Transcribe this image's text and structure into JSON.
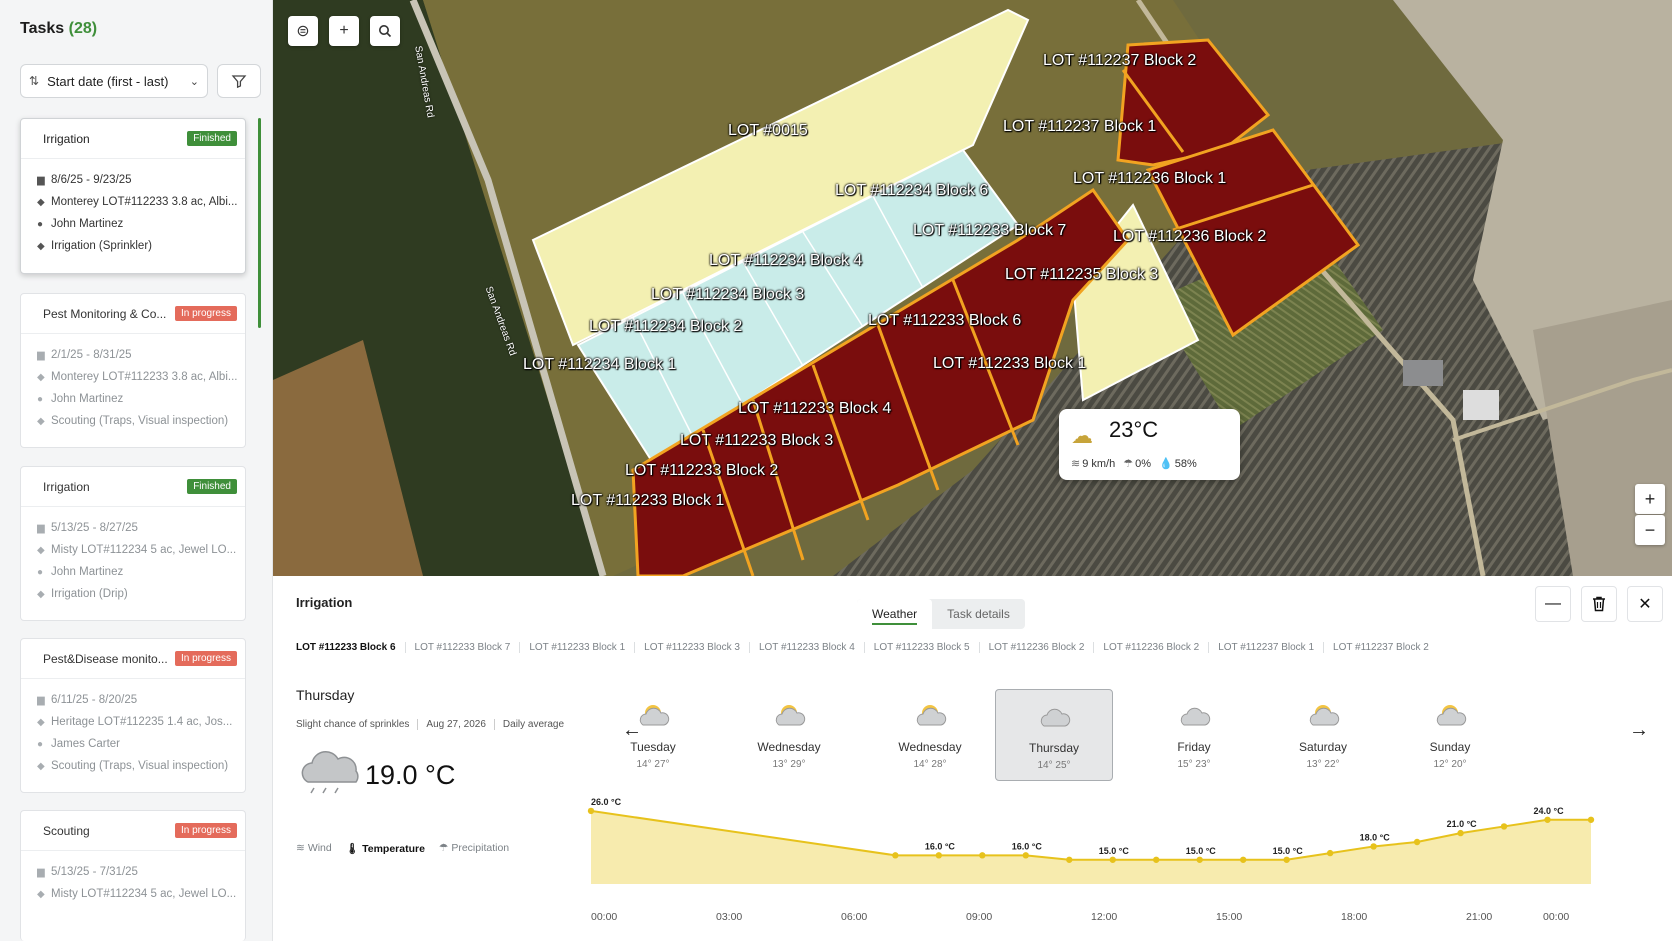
{
  "sidebar": {
    "title": "Tasks",
    "count": "(28)",
    "sort_label": "Start date (first - last)",
    "tasks": [
      {
        "name": "Irrigation",
        "status": "Finished",
        "status_type": "finished",
        "dates": "8/6/25 - 9/23/25",
        "location": "Monterey LOT#112233 3.8 ac, Albi...",
        "assignee": "John Martinez",
        "activity": "Irrigation (Sprinkler)"
      },
      {
        "name": "Pest Monitoring & Co...",
        "status": "In progress",
        "status_type": "progress",
        "dates": "2/1/25 - 8/31/25",
        "location": "Monterey LOT#112233 3.8 ac, Albi...",
        "assignee": "John Martinez",
        "activity": "Scouting (Traps, Visual inspection)"
      },
      {
        "name": "Irrigation",
        "status": "Finished",
        "status_type": "finished",
        "dates": "5/13/25 - 8/27/25",
        "location": "Misty LOT#112234 5 ac, Jewel LO...",
        "assignee": "John Martinez",
        "activity": "Irrigation (Drip)"
      },
      {
        "name": "Pest&Disease monito...",
        "status": "In progress",
        "status_type": "progress",
        "dates": "6/11/25 - 8/20/25",
        "location": "Heritage LOT#112235 1.4 ac, Jos...",
        "assignee": "James Carter",
        "activity": "Scouting (Traps, Visual inspection)"
      },
      {
        "name": "Scouting",
        "status": "In progress",
        "status_type": "progress",
        "dates": "5/13/25 - 7/31/25",
        "location": "Misty LOT#112234 5 ac, Jewel LO..."
      }
    ]
  },
  "map": {
    "roads": [
      "San Andreas Rd",
      "San Andreas Rd"
    ],
    "lots": [
      "LOT #0015",
      "LOT #112234 Block 6",
      "LOT #112234 Block 4",
      "LOT #112234 Block 3",
      "LOT #112234 Block 2",
      "LOT #112234 Block 1",
      "LOT #112237 Block 2",
      "LOT #112237 Block 1",
      "LOT #112236 Block 1",
      "LOT #112236 Block 2",
      "LOT #112233 Block 7",
      "LOT #112235 Block 3",
      "LOT #112233 Block 6",
      "LOT #112233 Block 1",
      "LOT #112233 Block 4",
      "LOT #112233 Block 3",
      "LOT #112233 Block 2",
      "LOT #112233 Block 1"
    ],
    "weather": {
      "temp": "23°C",
      "wind": "9 km/h",
      "precip": "0%",
      "humidity": "58%"
    },
    "colors": {
      "selected": "#7a0d0d",
      "selected_border": "#f2a321",
      "plain_lot": "#f3f0b2",
      "blue_lot": "#c9ece9"
    }
  },
  "panel": {
    "title": "Irrigation",
    "tabs": [
      "Weather",
      "Task details"
    ],
    "lot_tabs": [
      "LOT #112233 Block 6",
      "LOT #112233 Block 7",
      "LOT #112233 Block 1",
      "LOT #112233 Block 3",
      "LOT #112233 Block 4",
      "LOT #112233 Block 5",
      "LOT #112236 Block 2",
      "LOT #112236 Block 2",
      "LOT #112237 Block 1",
      "LOT #112237 Block 2"
    ],
    "day": {
      "name": "Thursday",
      "description": "Slight chance of sprinkles",
      "date": "Aug 27, 2026",
      "mode": "Daily average",
      "temp": "19.0 °C"
    },
    "metrics": [
      "Wind",
      "Temperature",
      "Precipitation"
    ],
    "forecast": [
      {
        "day": "Tuesday",
        "range": "14° 27°",
        "icon": "sun-cloud-icon"
      },
      {
        "day": "Wednesday",
        "range": "13° 29°",
        "icon": "sun-cloud-icon"
      },
      {
        "day": "Wednesday",
        "range": "14° 28°",
        "icon": "sun-cloud-icon"
      },
      {
        "day": "Thursday",
        "range": "14° 25°",
        "icon": "cloud-rain-icon"
      },
      {
        "day": "Friday",
        "range": "15° 23°",
        "icon": "cloud-rain-icon"
      },
      {
        "day": "Saturday",
        "range": "13° 22°",
        "icon": "sun-cloud-icon"
      },
      {
        "day": "Sunday",
        "range": "12° 20°",
        "icon": "sun-cloud-icon"
      }
    ]
  },
  "chart_data": {
    "type": "area",
    "x": [
      "00:00",
      "03:00",
      "06:00",
      "09:00",
      "12:00",
      "15:00",
      "18:00",
      "21:00",
      "00:00"
    ],
    "y": [
      26.0,
      null,
      null,
      16.0,
      16.0,
      15.0,
      15.0,
      15.0,
      18.0,
      21.0,
      24.0
    ],
    "points": [
      {
        "t": 0,
        "v": 26.0,
        "label": "26.0 °C"
      },
      {
        "t": 7,
        "v": 16.0,
        "label": ""
      },
      {
        "t": 8,
        "v": 16.0,
        "label": "16.0 °C"
      },
      {
        "t": 9,
        "v": 16.0,
        "label": ""
      },
      {
        "t": 10,
        "v": 16.0,
        "label": "16.0 °C"
      },
      {
        "t": 11,
        "v": 15.0,
        "label": ""
      },
      {
        "t": 12,
        "v": 15.0,
        "label": "15.0 °C"
      },
      {
        "t": 13,
        "v": 15.0,
        "label": ""
      },
      {
        "t": 14,
        "v": 15.0,
        "label": "15.0 °C"
      },
      {
        "t": 15,
        "v": 15.0,
        "label": ""
      },
      {
        "t": 16,
        "v": 15.0,
        "label": "15.0 °C"
      },
      {
        "t": 17,
        "v": 16.5,
        "label": ""
      },
      {
        "t": 18,
        "v": 18.0,
        "label": "18.0 °C"
      },
      {
        "t": 19,
        "v": 19.0,
        "label": ""
      },
      {
        "t": 20,
        "v": 21.0,
        "label": "21.0 °C"
      },
      {
        "t": 21,
        "v": 22.5,
        "label": ""
      },
      {
        "t": 22,
        "v": 24.0,
        "label": "24.0 °C"
      },
      {
        "t": 23,
        "v": 24.0,
        "label": ""
      }
    ],
    "tick_labels": [
      "00:00",
      "03:00",
      "06:00",
      "09:00",
      "12:00",
      "15:00",
      "18:00",
      "21:00",
      "00:00"
    ],
    "ylim": [
      10,
      28
    ],
    "colors": {
      "line": "#e7c21c",
      "fill": "#f6e7a0",
      "point": "#e7c21c"
    }
  }
}
